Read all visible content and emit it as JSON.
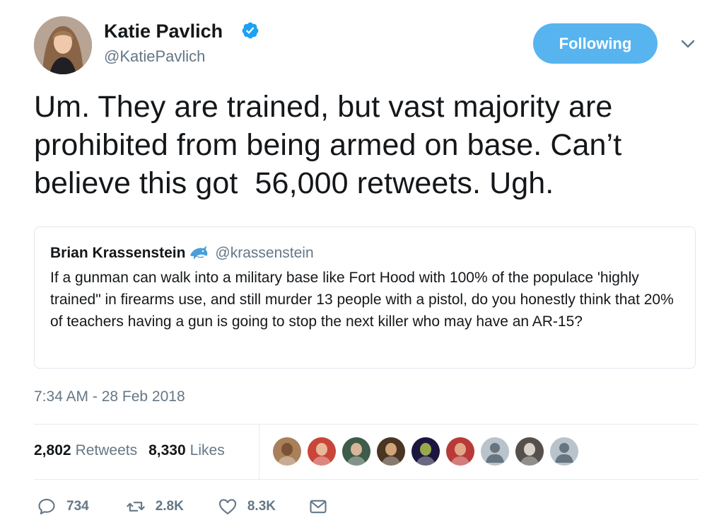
{
  "author": {
    "display_name": "Katie Pavlich",
    "handle": "@KatiePavlich",
    "verified": true
  },
  "follow_button_label": "Following",
  "tweet_text": "Um. They are trained, but vast majority are\nprohibited from being armed on base. Can’t\nbelieve this got  56,000 retweets. Ugh.",
  "quoted_tweet": {
    "name": "Brian Krassenstein",
    "emoji_icon": "dolphin-icon",
    "handle": "@krassenstein",
    "text": "If a gunman can walk into a military base like Fort Hood with 100% of the populace 'highly trained\" in firearms use, and still murder 13 people with a pistol, do you honestly think that 20% of teachers having a gun is going to stop the next killer who may have an AR-15?"
  },
  "timestamp": "7:34 AM - 28 Feb 2018",
  "stats": {
    "retweets_count": "2,802",
    "retweets_label": "Retweets",
    "likes_count": "8,330",
    "likes_label": "Likes"
  },
  "likers": [
    {
      "bg": "#a9805a",
      "face": "#7a5236"
    },
    {
      "bg": "#c9453a",
      "face": "#e8b89a"
    },
    {
      "bg": "#3f5b4a",
      "face": "#d9b59a"
    },
    {
      "bg": "#4a3424",
      "face": "#d2a47a"
    },
    {
      "bg": "#1b1640",
      "face": "#9aa84c"
    },
    {
      "bg": "#b83a38",
      "face": "#e0a888"
    },
    {
      "bg": "#b9c3cb",
      "face": "default"
    },
    {
      "bg": "#55504c",
      "face": "#d8d2cb"
    },
    {
      "bg": "#b9c3cb",
      "face": "default"
    }
  ],
  "actions": {
    "reply_count": "734",
    "retweet_count": "2.8K",
    "like_count": "8.3K"
  },
  "colors": {
    "accent": "#58b4ef",
    "secondary_text": "#657786",
    "verified": "#1da1f2"
  }
}
